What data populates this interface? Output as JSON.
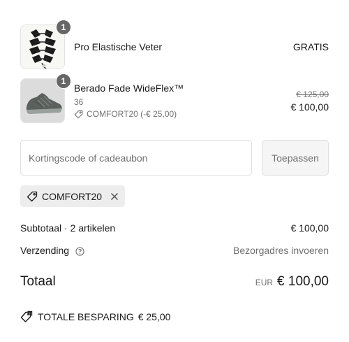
{
  "cart": {
    "items": [
      {
        "name": "Pro Elastische Veter",
        "quantity": "1",
        "price": "GRATIS",
        "thumbnail_icon": "laces-image"
      },
      {
        "name": "Berado Fade WideFlex™",
        "quantity": "1",
        "variant": "36",
        "discount_label": "COMFORT20 (-€ 25,00)",
        "original_price": "€ 125,00",
        "price": "€ 100,00",
        "thumbnail_icon": "shoe-image"
      }
    ]
  },
  "discount_form": {
    "placeholder": "Kortingscode of cadeaubon",
    "apply_label": "Toepassen"
  },
  "applied_code": {
    "code": "COMFORT20"
  },
  "summary": {
    "subtotal_label": "Subtotaal · 2 artikelen",
    "subtotal_value": "€ 100,00",
    "shipping_label": "Verzending",
    "shipping_value": "Bezorgadres invoeren",
    "total_label": "Totaal",
    "currency": "EUR",
    "total_value": "€ 100,00",
    "savings_label": "TOTALE BESPARING",
    "savings_value": "€ 25,00"
  },
  "colors": {
    "text": "#1a1a1a",
    "muted": "#707070",
    "badge": "#666666",
    "chip_bg": "#ededed",
    "border": "#dedede"
  }
}
